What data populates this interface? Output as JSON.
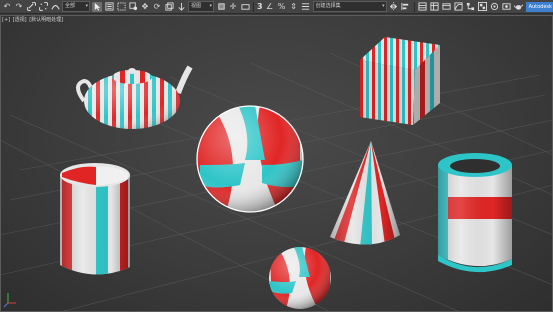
{
  "toolbar": {
    "select_filter": "全部",
    "view_coord": "视图",
    "snap_value": "3",
    "selection_set": "创建选择集",
    "active_button": "Autodesk A360"
  },
  "viewport": {
    "label_plus": "[+]",
    "label_view": "[透视]",
    "label_shading": "[默认明暗处理]"
  },
  "colors": {
    "stripe_red": "#e02222",
    "stripe_cyan": "#2ec5c8",
    "base_white": "#e9e9e9",
    "selection_outline": "#ffffff",
    "grid": "#5a5a5a",
    "accent_blue": "#3d7fd0"
  },
  "icons": {
    "undo": "undo-icon",
    "redo": "redo-icon",
    "link": "link-icon",
    "unlink": "unlink-icon",
    "select_object": "select-arrow-icon",
    "move": "move-icon",
    "rotate": "rotate-icon",
    "scale": "scale-icon",
    "snap": "snap-icon",
    "mirror": "mirror-icon",
    "align": "align-icon",
    "material_editor": "material-editor-icon",
    "render": "render-teapot-icon"
  }
}
